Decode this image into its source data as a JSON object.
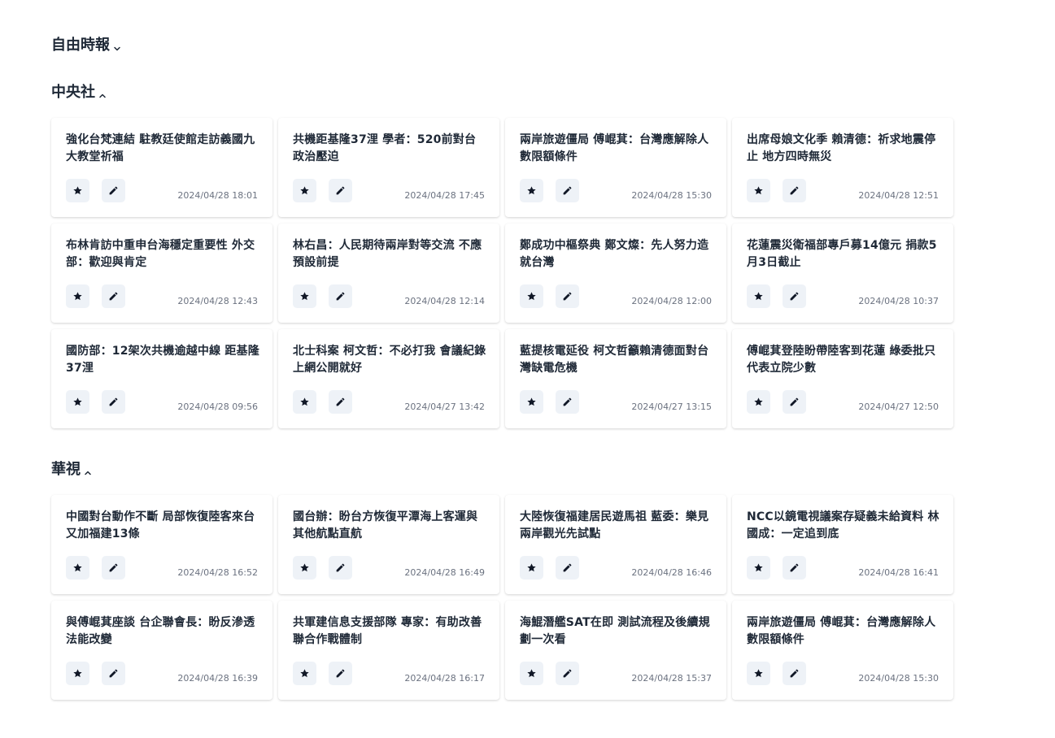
{
  "sections": [
    {
      "name": "自由時報",
      "expanded": false
    },
    {
      "name": "中央社",
      "expanded": true
    },
    {
      "name": "華視",
      "expanded": true
    }
  ],
  "cna": [
    {
      "title": "強化台梵連結 駐教廷使館走訪義國九大教堂祈福",
      "date": "2024/04/28 18:01"
    },
    {
      "title": "共機距基隆37浬 學者：520前對台政治壓迫",
      "date": "2024/04/28 17:45"
    },
    {
      "title": "兩岸旅遊僵局 傅崐萁：台灣應解除人數限額條件",
      "date": "2024/04/28 15:30"
    },
    {
      "title": "出席母娘文化季 賴清德：祈求地震停止 地方四時無災",
      "date": "2024/04/28 12:51"
    },
    {
      "title": "布林肯訪中重申台海穩定重要性 外交部：歡迎與肯定",
      "date": "2024/04/28 12:43"
    },
    {
      "title": "林右昌：人民期待兩岸對等交流 不應預設前提",
      "date": "2024/04/28 12:14"
    },
    {
      "title": "鄭成功中樞祭典 鄭文燦：先人努力造就台灣",
      "date": "2024/04/28 12:00"
    },
    {
      "title": "花蓮震災衛福部專戶募14億元 捐款5月3日截止",
      "date": "2024/04/28 10:37"
    },
    {
      "title": "國防部：12架次共機逾越中線 距基隆37浬",
      "date": "2024/04/28 09:56"
    },
    {
      "title": "北士科案 柯文哲：不必打我 會議紀錄上網公開就好",
      "date": "2024/04/27 13:42"
    },
    {
      "title": "藍提核電延役 柯文哲籲賴清德面對台灣缺電危機",
      "date": "2024/04/27 13:15"
    },
    {
      "title": "傅崐萁登陸盼帶陸客到花蓮 綠委批只代表立院少數",
      "date": "2024/04/27 12:50"
    }
  ],
  "cts": [
    {
      "title": "中國對台動作不斷 局部恢復陸客來台又加福建13條",
      "date": "2024/04/28 16:52"
    },
    {
      "title": "國台辦：盼台方恢復平潭海上客運與其他航點直航",
      "date": "2024/04/28 16:49"
    },
    {
      "title": "大陸恢復福建居民遊馬祖 藍委：樂見兩岸觀光先試點",
      "date": "2024/04/28 16:46"
    },
    {
      "title": "NCC以鏡電視議案存疑義未給資料 林國成：一定追到底",
      "date": "2024/04/28 16:41"
    },
    {
      "title": "與傅崐萁座談 台企聯會長：盼反滲透法能改變",
      "date": "2024/04/28 16:39"
    },
    {
      "title": "共軍建信息支援部隊 專家：有助改善聯合作戰體制",
      "date": "2024/04/28 16:17"
    },
    {
      "title": "海鯤潛艦SAT在即 測試流程及後續規劃一次看",
      "date": "2024/04/28 15:37"
    },
    {
      "title": "兩岸旅遊僵局 傅崐萁：台灣應解除人數限額條件",
      "date": "2024/04/28 15:30"
    }
  ],
  "icons": {
    "favorite": "star-icon",
    "edit": "pencil-icon",
    "collapsed": "chevron-down-icon",
    "expanded": "chevron-up-icon"
  },
  "colors": {
    "button_bg": "#eef2f7",
    "text": "#1f2937",
    "date": "#6b7280"
  }
}
